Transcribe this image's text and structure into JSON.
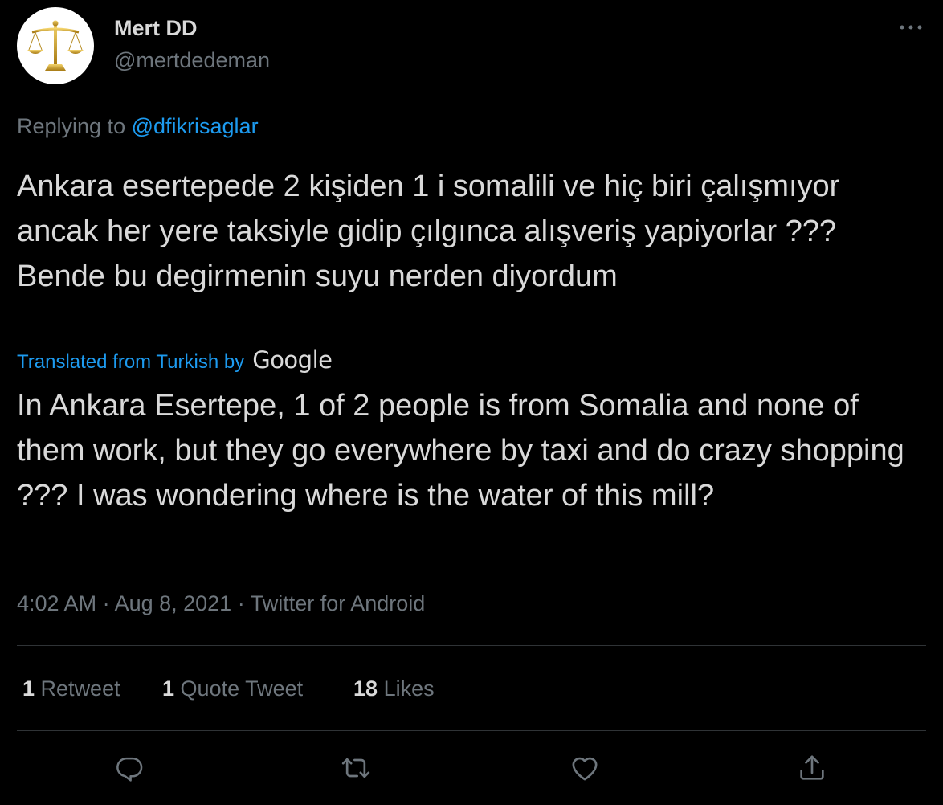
{
  "author": {
    "display_name": "Mert DD",
    "handle": "@mertdedeman"
  },
  "reply": {
    "prefix": "Replying to",
    "to": "@dfikrisaglar"
  },
  "tweet": {
    "text": "Ankara esertepede 2 kişiden 1 i somalili ve hiç biri çalışmıyor ancak her yere taksiyle gidip çılgınca alışveriş yapiyorlar ??? Bende bu degirmenin suyu nerden diyordum"
  },
  "translation": {
    "label": "Translated from Turkish by",
    "provider": "Google",
    "text": "In Ankara Esertepe, 1 of 2 people is from Somalia and none of them work, but they go everywhere by taxi and do crazy shopping ??? I was wondering where is the water of this mill?"
  },
  "meta": {
    "time": "4:02 AM · Aug 8, 2021 · Twitter for Android"
  },
  "stats": {
    "retweets": "1",
    "retweets_label": "Retweet",
    "quotes": "1",
    "quotes_label": "Quote Tweet",
    "likes": "18",
    "likes_label": "Likes"
  },
  "actions": [
    "reply-icon",
    "retweet-icon",
    "like-icon",
    "share-icon"
  ],
  "colors": {
    "background": "#000000",
    "text": "#d9d9d9",
    "secondary": "#6e767d",
    "link": "#1d9bf0",
    "divider": "#2f3336",
    "scale_gold": "#c9a227"
  }
}
